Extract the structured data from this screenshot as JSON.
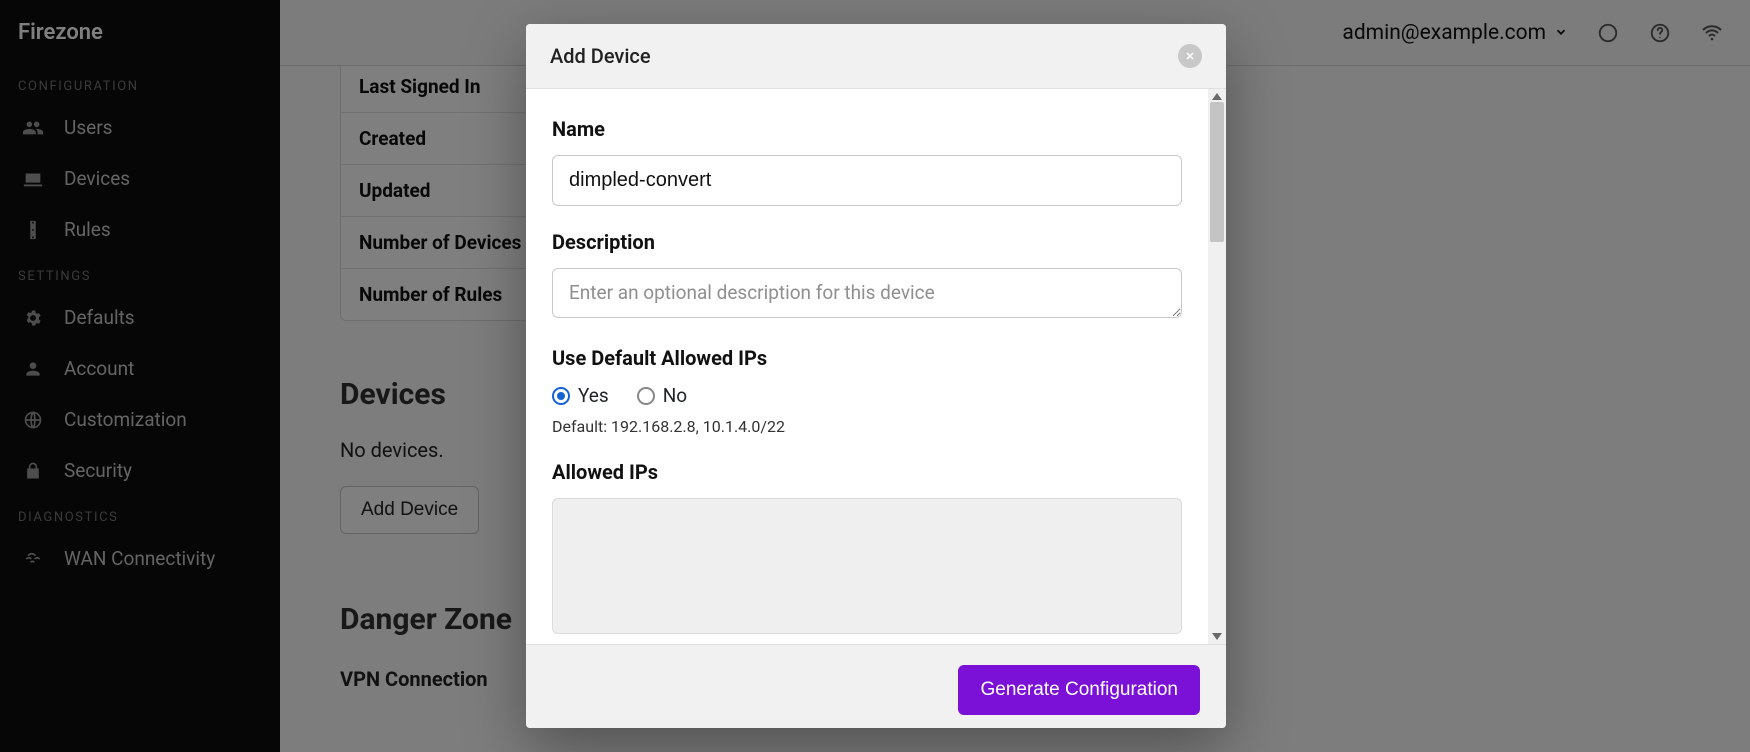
{
  "brand": "Firezone",
  "sidebar": {
    "sections": [
      {
        "title": "CONFIGURATION",
        "items": [
          {
            "label": "Users",
            "icon": "users-icon"
          },
          {
            "label": "Devices",
            "icon": "laptop-icon"
          },
          {
            "label": "Rules",
            "icon": "traffic-icon"
          }
        ]
      },
      {
        "title": "SETTINGS",
        "items": [
          {
            "label": "Defaults",
            "icon": "gear-icon"
          },
          {
            "label": "Account",
            "icon": "person-icon"
          },
          {
            "label": "Customization",
            "icon": "globe-icon"
          },
          {
            "label": "Security",
            "icon": "lock-icon"
          }
        ]
      },
      {
        "title": "DIAGNOSTICS",
        "items": [
          {
            "label": "WAN Connectivity",
            "icon": "signal-icon"
          }
        ]
      }
    ]
  },
  "topbar": {
    "user_email": "admin@example.com"
  },
  "details": {
    "rows": [
      {
        "key": "Last Signed In"
      },
      {
        "key": "Created"
      },
      {
        "key": "Updated"
      },
      {
        "key": "Number of Devices"
      },
      {
        "key": "Number of Rules"
      }
    ]
  },
  "sections": {
    "devices_heading": "Devices",
    "devices_empty": "No devices.",
    "add_device_btn": "Add Device",
    "danger_heading": "Danger Zone",
    "vpn_sub": "VPN Connection"
  },
  "modal": {
    "title": "Add Device",
    "name_label": "Name",
    "name_value": "dimpled-convert",
    "desc_label": "Description",
    "desc_placeholder": "Enter an optional description for this device",
    "use_default_label": "Use Default Allowed IPs",
    "radio_yes": "Yes",
    "radio_no": "No",
    "default_hint": "Default: 192.168.2.8, 10.1.4.0/22",
    "allowed_ips_label": "Allowed IPs",
    "submit_label": "Generate Configuration"
  }
}
